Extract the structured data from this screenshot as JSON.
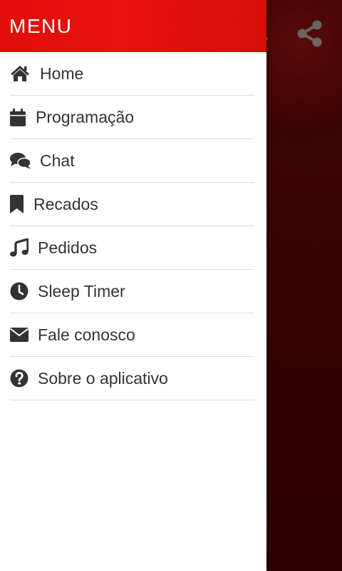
{
  "drawer": {
    "title": "MENU",
    "items": [
      {
        "label": "Home",
        "icon": "home-icon"
      },
      {
        "label": "Programação",
        "icon": "calendar-icon"
      },
      {
        "label": "Chat",
        "icon": "chat-bubbles-icon"
      },
      {
        "label": "Recados",
        "icon": "bookmark-icon"
      },
      {
        "label": "Pedidos",
        "icon": "music-note-icon"
      },
      {
        "label": "Sleep Timer",
        "icon": "clock-icon"
      },
      {
        "label": "Fale conosco",
        "icon": "envelope-icon"
      },
      {
        "label": "Sobre o aplicativo",
        "icon": "question-circle-icon"
      }
    ]
  },
  "background": {
    "share_icon": "share-icon"
  },
  "colors": {
    "header_red": "#e8130c",
    "icon_dark": "#333333",
    "backdrop": "#3a0000",
    "divider": "#dcdcdc"
  }
}
